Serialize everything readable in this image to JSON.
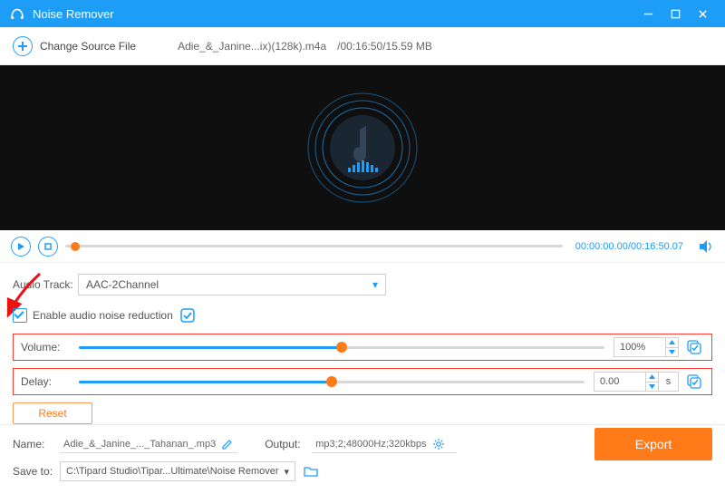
{
  "titlebar": {
    "title": "Noise Remover"
  },
  "toolbar": {
    "change_source": "Change Source File",
    "filename": "Adie_&_Janine...ix)(128k).m4a",
    "duration_size": "/00:16:50/15.59 MB"
  },
  "seek": {
    "time": "00:00:00.00/00:16:50.07"
  },
  "audio_track": {
    "label": "Audio Track:",
    "value": "AAC-2Channel"
  },
  "enable_noise": {
    "label": "Enable audio noise reduction",
    "checked": true
  },
  "volume": {
    "label": "Volume:",
    "value": "100%",
    "percent": 50
  },
  "delay": {
    "label": "Delay:",
    "value": "0.00",
    "unit": "s",
    "percent": 50
  },
  "reset": {
    "label": "Reset"
  },
  "footer": {
    "name_label": "Name:",
    "name_value": "Adie_&_Janine_..._Tahanan_.mp3",
    "output_label": "Output:",
    "output_value": "mp3;2;48000Hz;320kbps",
    "save_label": "Save to:",
    "save_value": "C:\\Tipard Studio\\Tipar...Ultimate\\Noise Remover",
    "export": "Export"
  }
}
